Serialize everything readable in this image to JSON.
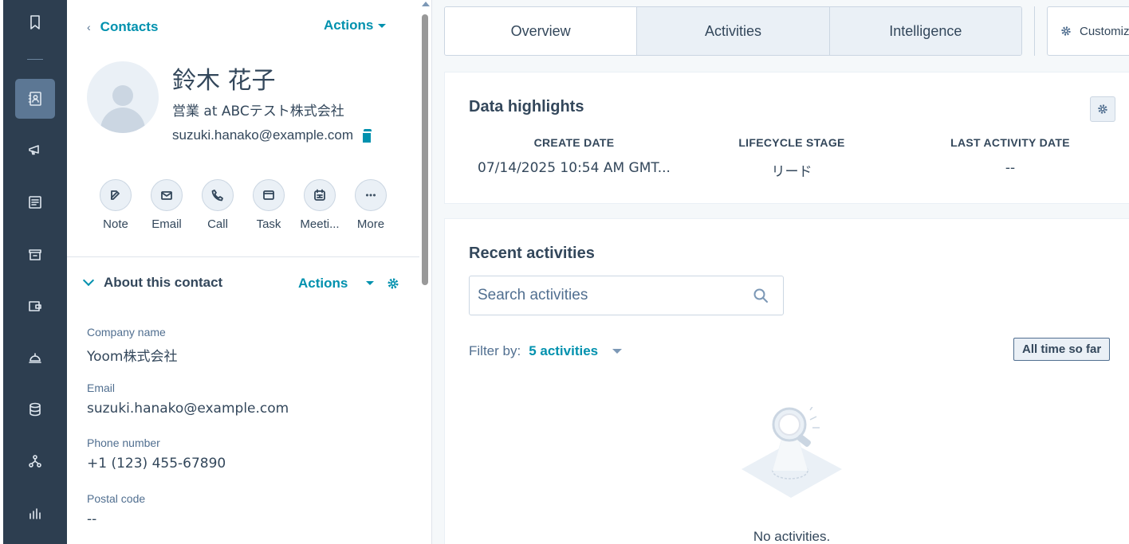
{
  "rail": {
    "items": [
      {
        "name": "bookmark-icon",
        "active": false
      },
      {
        "name": "contacts-icon",
        "active": true
      },
      {
        "name": "megaphone-icon",
        "active": false
      },
      {
        "name": "content-icon",
        "active": false
      },
      {
        "name": "commerce-icon",
        "active": false
      },
      {
        "name": "wallet-icon",
        "active": false
      },
      {
        "name": "service-bell-icon",
        "active": false
      },
      {
        "name": "database-icon",
        "active": false
      },
      {
        "name": "automation-icon",
        "active": false
      },
      {
        "name": "reports-icon",
        "active": false
      }
    ]
  },
  "contact": {
    "back_label": "Contacts",
    "actions_label": "Actions",
    "name": "鈴木 花子",
    "title": "営業 at ABCテスト株式会社",
    "email": "suzuki.hanako@example.com",
    "quick_actions": [
      {
        "label": "Note",
        "icon": "note-icon"
      },
      {
        "label": "Email",
        "icon": "email-icon"
      },
      {
        "label": "Call",
        "icon": "call-icon"
      },
      {
        "label": "Task",
        "icon": "task-icon"
      },
      {
        "label": "Meeti...",
        "icon": "meeting-icon"
      },
      {
        "label": "More",
        "icon": "more-icon"
      }
    ]
  },
  "about": {
    "title": "About this contact",
    "actions_label": "Actions",
    "fields": [
      {
        "label": "Company name",
        "value": "Yoom株式会社"
      },
      {
        "label": "Email",
        "value": "suzuki.hanako@example.com"
      },
      {
        "label": "Phone number",
        "value": "+1 (123) 455-67890"
      },
      {
        "label": "Postal code",
        "value": "--"
      }
    ]
  },
  "tabs": {
    "items": [
      "Overview",
      "Activities",
      "Intelligence"
    ],
    "active": "Overview",
    "customize_label": "Customiz"
  },
  "highlights": {
    "title": "Data highlights",
    "columns": [
      {
        "header": "CREATE DATE",
        "value": "07/14/2025 10:54 AM GMT..."
      },
      {
        "header": "LIFECYCLE STAGE",
        "value": "リード"
      },
      {
        "header": "LAST ACTIVITY DATE",
        "value": "--"
      }
    ]
  },
  "activities": {
    "title": "Recent activities",
    "search_placeholder": "Search activities",
    "filter_label": "Filter by:",
    "filter_value": "5 activities",
    "time_range": "All time so far",
    "empty_text": "No activities."
  },
  "colors": {
    "rail_bg": "#2d3e50",
    "rail_active": "#5c7794",
    "accent": "#0091ae",
    "text": "#33475b"
  }
}
